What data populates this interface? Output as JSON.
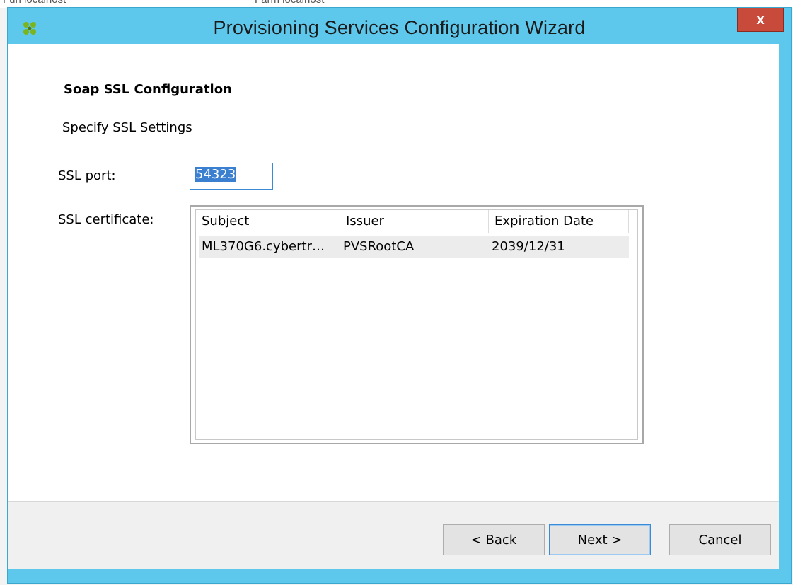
{
  "background": {
    "left_text": "Fun localhost",
    "right_text": "Farm localhost"
  },
  "window": {
    "title": "Provisioning Services Configuration Wizard",
    "close_label": "x",
    "accent_color": "#5ec8ec",
    "close_color": "#c84a3a"
  },
  "page": {
    "title": "Soap SSL Configuration",
    "subtitle": "Specify SSL Settings"
  },
  "form": {
    "ssl_port_label": "SSL port:",
    "ssl_port_value": "54323",
    "ssl_certificate_label": "SSL certificate:"
  },
  "cert_table": {
    "columns": [
      "Subject",
      "Issuer",
      "Expiration Date"
    ],
    "rows": [
      [
        "ML370G6.cybertr…",
        "PVSRootCA",
        "2039/12/31"
      ]
    ]
  },
  "buttons": {
    "back": "< Back",
    "next": "Next >",
    "cancel": "Cancel"
  }
}
